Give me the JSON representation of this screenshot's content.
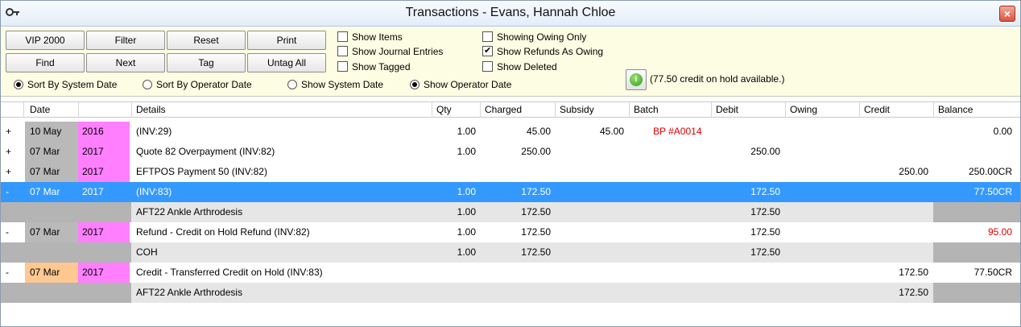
{
  "window": {
    "title": "Transactions - Evans, Hannah Chloe",
    "close_label": "×"
  },
  "toolbar": {
    "buttons": [
      "VIP 2000",
      "Filter",
      "Reset",
      "Print",
      "Find",
      "Next",
      "Tag",
      "Untag All"
    ],
    "checkboxes": [
      {
        "label": "Show Items",
        "checked": false
      },
      {
        "label": "Show Journal Entries",
        "checked": false
      },
      {
        "label": "Show Tagged",
        "checked": false
      },
      {
        "label": "Showing Owing Only",
        "checked": false
      },
      {
        "label": "Show Refunds As Owing",
        "checked": true
      },
      {
        "label": "Show Deleted",
        "checked": false
      }
    ],
    "radios": [
      {
        "label": "Sort By System Date",
        "selected": true
      },
      {
        "label": "Sort By Operator Date",
        "selected": false
      },
      {
        "label": "Show System Date",
        "selected": false
      },
      {
        "label": "Show Operator Date",
        "selected": true
      }
    ],
    "info_icon": "info-icon",
    "credit_note": "(77.50 credit on hold available.)"
  },
  "table": {
    "columns": [
      "Date",
      "Details",
      "Qty",
      "Charged",
      "Subsidy",
      "Batch",
      "Debit",
      "Owing",
      "Credit",
      "Balance"
    ],
    "rows": [
      {
        "exp": "+",
        "date": "10 May",
        "year": "2016",
        "details": "(INV:29)",
        "qty": "1.00",
        "charged": "45.00",
        "subsidy": "45.00",
        "batch": "BP #A0014",
        "debit": "",
        "owing": "",
        "credit": "",
        "balance": "0.00"
      },
      {
        "exp": "+",
        "date": "07 Mar",
        "year": "2017",
        "details": "Quote 82 Overpayment (INV:82)",
        "qty": "1.00",
        "charged": "250.00",
        "subsidy": "",
        "batch": "",
        "debit": "250.00",
        "owing": "",
        "credit": "",
        "balance": ""
      },
      {
        "exp": "+",
        "date": "07 Mar",
        "year": "2017",
        "details": "EFTPOS Payment  50 (INV:82)",
        "qty": "",
        "charged": "",
        "subsidy": "",
        "batch": "",
        "debit": "",
        "owing": "",
        "credit": "250.00",
        "balance": "250.00CR"
      },
      {
        "exp": "-",
        "date": "07 Mar",
        "year": "2017",
        "details": "(INV:83)",
        "qty": "1.00",
        "charged": "172.50",
        "subsidy": "",
        "batch": "",
        "debit": "172.50",
        "owing": "",
        "credit": "",
        "balance": "77.50CR"
      },
      {
        "exp": "",
        "date": "",
        "year": "",
        "details": "AFT22 Ankle Arthrodesis",
        "qty": "1.00",
        "charged": "172.50",
        "subsidy": "",
        "batch": "",
        "debit": "172.50",
        "owing": "",
        "credit": "",
        "balance": ""
      },
      {
        "exp": "-",
        "date": "07 Mar",
        "year": "2017",
        "details": "Refund - Credit on Hold Refund (INV:82)",
        "qty": "1.00",
        "charged": "172.50",
        "subsidy": "",
        "batch": "",
        "debit": "172.50",
        "owing": "",
        "credit": "",
        "balance": "95.00"
      },
      {
        "exp": "",
        "date": "",
        "year": "",
        "details": "COH",
        "qty": "1.00",
        "charged": "172.50",
        "subsidy": "",
        "batch": "",
        "debit": "172.50",
        "owing": "",
        "credit": "",
        "balance": ""
      },
      {
        "exp": "-",
        "date": "07 Mar",
        "year": "2017",
        "details": "Credit - Transferred Credit on Hold (INV:83)",
        "qty": "",
        "charged": "",
        "subsidy": "",
        "batch": "",
        "debit": "",
        "owing": "",
        "credit": "172.50",
        "balance": "77.50CR"
      },
      {
        "exp": "",
        "date": "",
        "year": "",
        "details": "AFT22 Ankle Arthrodesis",
        "qty": "",
        "charged": "",
        "subsidy": "",
        "batch": "",
        "debit": "",
        "owing": "",
        "credit": "172.50",
        "balance": ""
      }
    ]
  },
  "colors": {
    "selected": "#3399ff",
    "year_highlight": "#ff7fff",
    "date_orange": "#ffc891",
    "red_text": "#e00000",
    "toolbar_bg": "#fdfde3"
  }
}
